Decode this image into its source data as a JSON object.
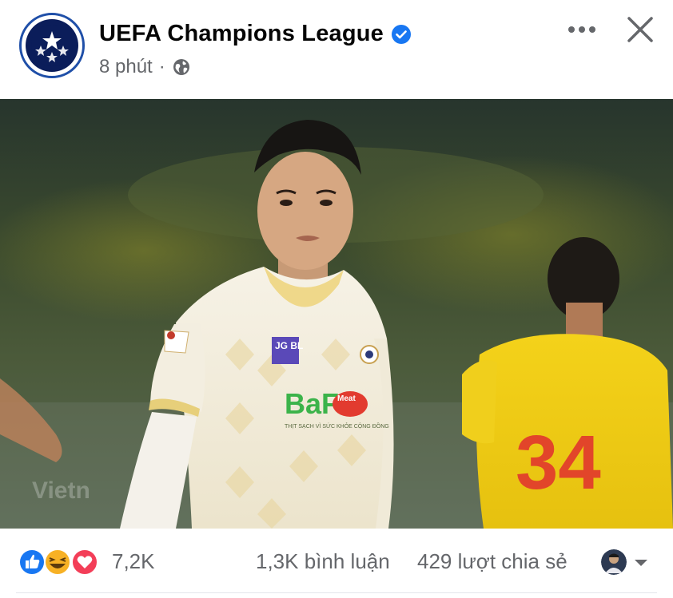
{
  "post": {
    "page_name": "UEFA Champions League",
    "time": "8 phút",
    "separator": "·"
  },
  "photo": {
    "watermark": "Vietn",
    "kit_sponsor_1": "JG BL",
    "kit_sponsor_2": "BaF",
    "kit_sponsor_2_badge": "Meat",
    "kit_slogan": "THỊT SẠCH VÌ SỨC KHỎE CỘNG ĐỒNG",
    "opponent_number": "34"
  },
  "stats": {
    "reactions": "7,2K",
    "comments": "1,3K bình luận",
    "shares": "429 lượt chia sẻ"
  },
  "colors": {
    "verified_blue": "#1877f2",
    "like_blue": "#1877f2",
    "love_red": "#f33e58",
    "haha_yellow": "#f7b125",
    "meta_gray": "#65676b"
  },
  "icons": [
    "avatar-logo-icon",
    "verified-badge-icon",
    "globe-icon",
    "more-options-icon",
    "close-icon",
    "like-reaction-icon",
    "haha-reaction-icon",
    "love-reaction-icon",
    "chevron-down-icon"
  ]
}
